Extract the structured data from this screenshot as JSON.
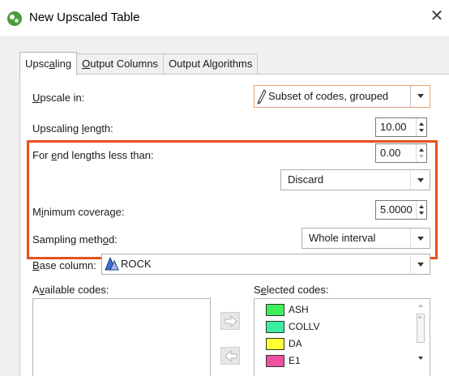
{
  "window": {
    "title": "New Upscaled Table",
    "close_icon": "close-icon"
  },
  "tabs": [
    {
      "pre": "Upsc",
      "key": "a",
      "post": "ling",
      "active": true
    },
    {
      "pre": "",
      "key": "O",
      "post": "utput Columns",
      "active": false
    },
    {
      "pre": "Output Algorithms",
      "key": "",
      "post": "",
      "active": false
    }
  ],
  "upscale_in": {
    "label_key": "U",
    "label_rest": "pscale in:",
    "value": "Subset of codes, grouped",
    "icon": "pencil-icon"
  },
  "upscaling_length": {
    "label_pre": "Upscaling ",
    "label_key": "l",
    "label_post": "ength:",
    "value": "10.00"
  },
  "end_lengths": {
    "label_pre": "For ",
    "label_key": "e",
    "label_post": "nd lengths less than:",
    "value": "0.00"
  },
  "end_action": {
    "value": "Discard"
  },
  "minimum_coverage": {
    "label_pre": "M",
    "label_key": "i",
    "label_post": "nimum coverage:",
    "value": "5.0000"
  },
  "sampling_method": {
    "label_pre": "Sampling meth",
    "label_key": "o",
    "label_post": "d:",
    "value": "Whole interval"
  },
  "base_column": {
    "label_key": "B",
    "label_rest": "ase column:",
    "value": "ROCK",
    "icon": "category-column-icon"
  },
  "available_codes": {
    "label_pre": "A",
    "label_key": "v",
    "label_post": "ailable codes:"
  },
  "selected_codes": {
    "label_pre": "S",
    "label_key": "e",
    "label_post": "lected codes:",
    "items": [
      {
        "label": "ASH",
        "color": "#3cf05a"
      },
      {
        "label": "COLLV",
        "color": "#3ceea0"
      },
      {
        "label": "DA",
        "color": "#ffff33"
      },
      {
        "label": "E1",
        "color": "#f050a0"
      }
    ]
  },
  "colors": {
    "highlight_border": "#e8501a",
    "titlebar_bg": "#ffffff",
    "dialog_bg": "#f0f0f0"
  }
}
